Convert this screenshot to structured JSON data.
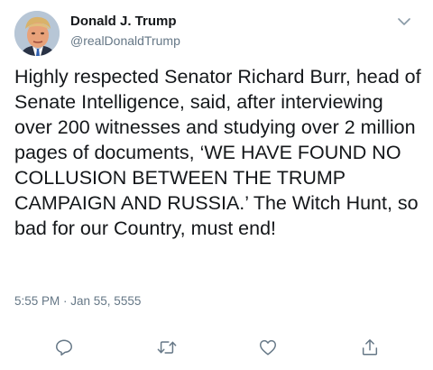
{
  "user": {
    "display_name": "Donald J. Trump",
    "handle": "@realDonaldTrump"
  },
  "tweet": {
    "text": "Highly respected Senator Richard Burr, head of Senate Intelligence, said, after interviewing over 200 witnesses and studying over 2 million pages of documents, ‘WE HAVE FOUND NO COLLUSION BETWEEN THE TRUMP CAMPAIGN AND RUSSIA.’ The Witch Hunt, so bad for our Country, must end!",
    "timestamp": "5:55 PM · Jan 55, 5555"
  },
  "icons": {
    "caret": "chevron-down-icon",
    "reply": "reply-icon",
    "retweet": "retweet-icon",
    "like": "heart-icon",
    "share": "share-icon"
  },
  "colors": {
    "text": "#14171a",
    "secondary": "#657786",
    "icon": "#657786"
  }
}
